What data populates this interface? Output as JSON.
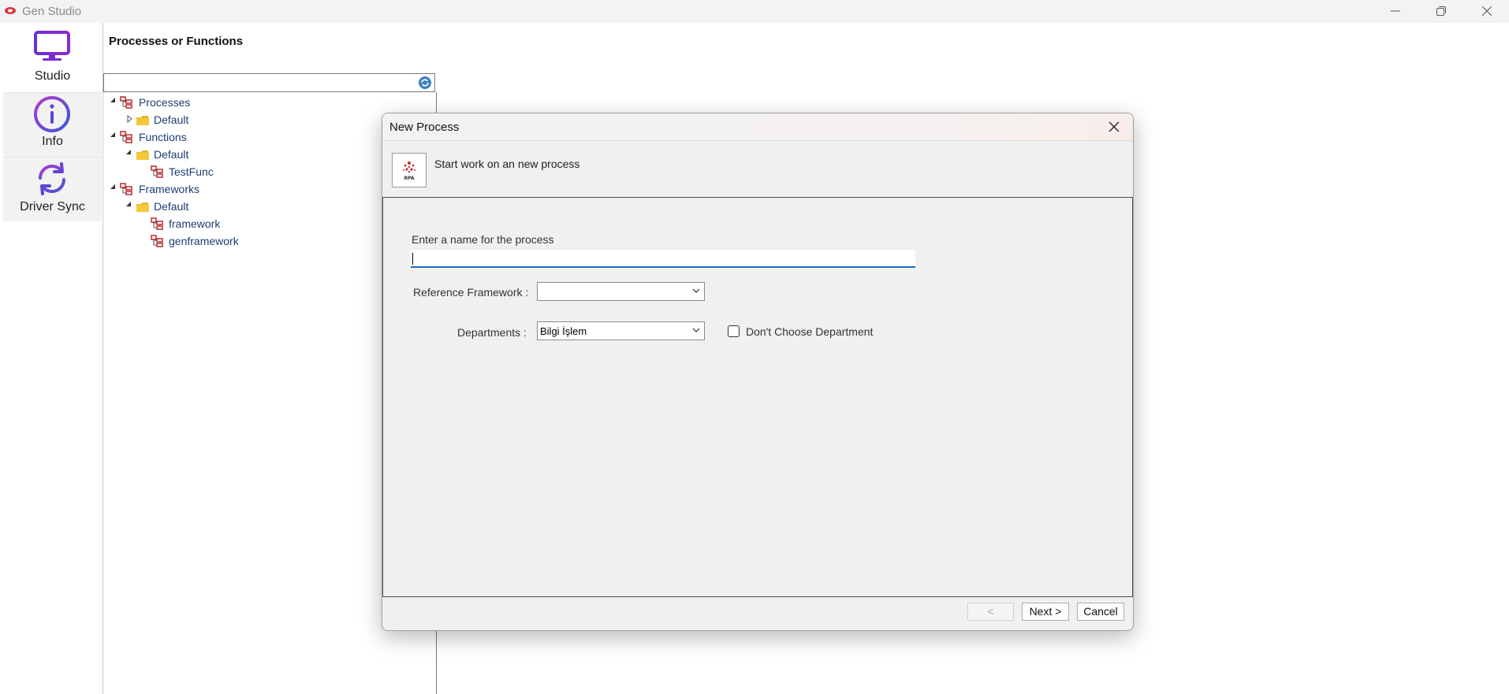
{
  "app": {
    "title": "Gen Studio"
  },
  "nav": {
    "items": [
      {
        "label": "Studio",
        "icon": "monitor-icon"
      },
      {
        "label": "Info",
        "icon": "info-icon"
      },
      {
        "label": "Driver Sync",
        "icon": "sync-icon"
      }
    ]
  },
  "panel": {
    "title": "Processes or Functions",
    "search_value": ""
  },
  "tree": {
    "processes": "Processes",
    "processes_default": "Default",
    "functions": "Functions",
    "functions_default": "Default",
    "testfunc": "TestFunc",
    "frameworks": "Frameworks",
    "frameworks_default": "Default",
    "framework": "framework",
    "genframework": "genframework"
  },
  "dialog": {
    "title": "New Process",
    "subtitle": "Start work on an new process",
    "name_label": "Enter a name for the process",
    "name_value": "",
    "ref_label": "Reference Framework :",
    "ref_value": "",
    "dep_label": "Departments :",
    "dep_value": "Bilgi İşlem",
    "no_dep_label": "Don't Choose Department",
    "no_dep_checked": false,
    "back_label": "<",
    "next_label": "Next >",
    "cancel_label": "Cancel"
  },
  "colors": {
    "accent": "#1f6fb8",
    "tree_text": "#1d3d73",
    "nav_icon_purple": "#7b2bd6",
    "folder": "#e8b82a",
    "node_red": "#c0282c"
  }
}
